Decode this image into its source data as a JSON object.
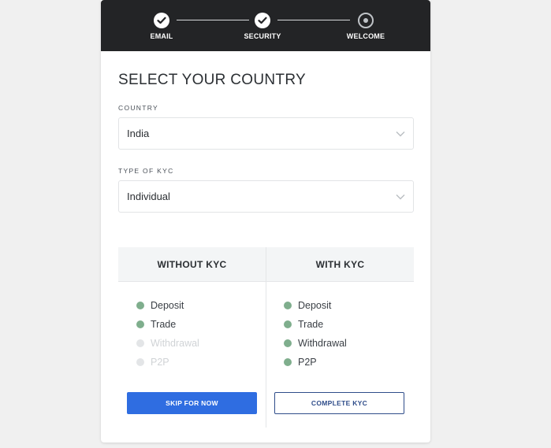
{
  "stepper": {
    "steps": [
      {
        "label": "EMAIL",
        "status": "done"
      },
      {
        "label": "SECURITY",
        "status": "done"
      },
      {
        "label": "WELCOME",
        "status": "current"
      }
    ]
  },
  "main": {
    "title": "SELECT YOUR COUNTRY",
    "country": {
      "label": "COUNTRY",
      "value": "India"
    },
    "kyc_type": {
      "label": "TYPE OF KYC",
      "value": "Individual"
    }
  },
  "comparison": {
    "without_kyc": {
      "heading": "WITHOUT KYC",
      "features": [
        {
          "label": "Deposit",
          "enabled": true
        },
        {
          "label": "Trade",
          "enabled": true
        },
        {
          "label": "Withdrawal",
          "enabled": false
        },
        {
          "label": "P2P",
          "enabled": false
        }
      ],
      "button": "SKIP FOR NOW"
    },
    "with_kyc": {
      "heading": "WITH KYC",
      "features": [
        {
          "label": "Deposit",
          "enabled": true
        },
        {
          "label": "Trade",
          "enabled": true
        },
        {
          "label": "Withdrawal",
          "enabled": true
        },
        {
          "label": "P2P",
          "enabled": true
        }
      ],
      "button": "COMPLETE KYC"
    }
  },
  "colors": {
    "header_bg": "#232426",
    "primary_button": "#2f6de1",
    "feature_enabled_dot": "#7fae8d"
  }
}
